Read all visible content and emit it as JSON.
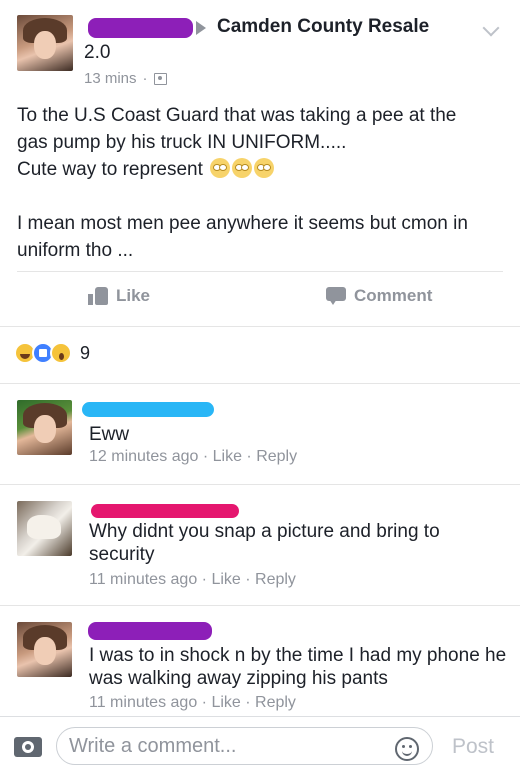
{
  "post": {
    "group_name": "Camden County Resale",
    "author_suffix": "2.0",
    "time": "13 mins",
    "separator": "·",
    "body_lines": [
      "To the U.S Coast Guard that was taking a pee at the",
      "gas pump by his truck IN UNIFORM.....",
      "Cute way to represent"
    ],
    "body_paragraph2": "I mean most men pee anywhere it seems but cmon in uniform tho ..."
  },
  "actions": {
    "like_label": "Like",
    "comment_label": "Comment"
  },
  "reactions": {
    "count": "9"
  },
  "comments": [
    {
      "text": "Eww",
      "time": "12 minutes ago",
      "like": "Like",
      "reply": "Reply",
      "redact_color": "#29b6f6"
    },
    {
      "text": "Why didnt you snap a picture and bring to security",
      "time": "11 minutes ago",
      "like": "Like",
      "reply": "Reply",
      "redact_color": "#e5176f"
    },
    {
      "text": "I was to in shock n by the time I had my phone he was walking away zipping his pants",
      "time": "11 minutes ago",
      "like": "Like",
      "reply": "Reply",
      "redact_color": "#8d1fb8"
    }
  ],
  "composer": {
    "placeholder": "Write a comment...",
    "post_label": "Post"
  },
  "colors": {
    "redact_author": "#8d1fb8",
    "meta_gray": "#90949c",
    "text": "#1d2129"
  },
  "icons": [
    "chevron-down-icon",
    "group-privacy-icon",
    "like-icon",
    "comment-icon",
    "camera-icon",
    "smiley-icon",
    "rolling-eyes-emoji"
  ]
}
